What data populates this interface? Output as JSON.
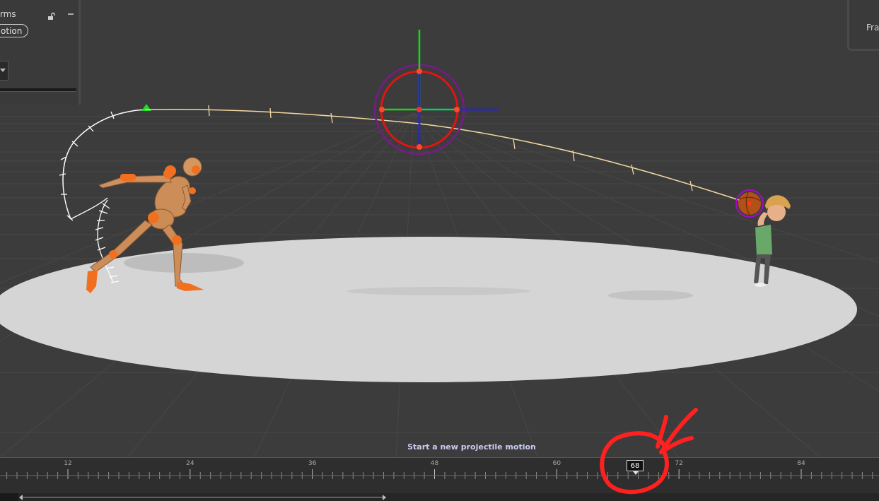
{
  "panel": {
    "title": "rms",
    "pill_button": "otion",
    "lock_icon": "unlock-icon",
    "collapse_icon": "minimize-icon"
  },
  "right_panel": {
    "label": "Fra"
  },
  "viewport": {
    "status_text": "Start a new projectile motion",
    "colors": {
      "background": "#3c3c3c",
      "grid": "#4a4a4a",
      "ground": "#d4d4d4",
      "trajectory_past": "#ffffff",
      "trajectory_future": "#f3d9a0",
      "gizmo_x": "#1f1fff",
      "gizmo_y": "#16d816",
      "gizmo_ring": "#e01414",
      "gizmo_outer_ring": "#8a1a9a",
      "annotation": "#ff2020"
    }
  },
  "timeline": {
    "ticks": [
      {
        "label": "12",
        "frame": 12
      },
      {
        "label": "24",
        "frame": 24
      },
      {
        "label": "36",
        "frame": 36
      },
      {
        "label": "48",
        "frame": 48
      },
      {
        "label": "60",
        "frame": 60
      },
      {
        "label": "72",
        "frame": 72
      },
      {
        "label": "84",
        "frame": 84
      }
    ],
    "current_frame": "68"
  }
}
